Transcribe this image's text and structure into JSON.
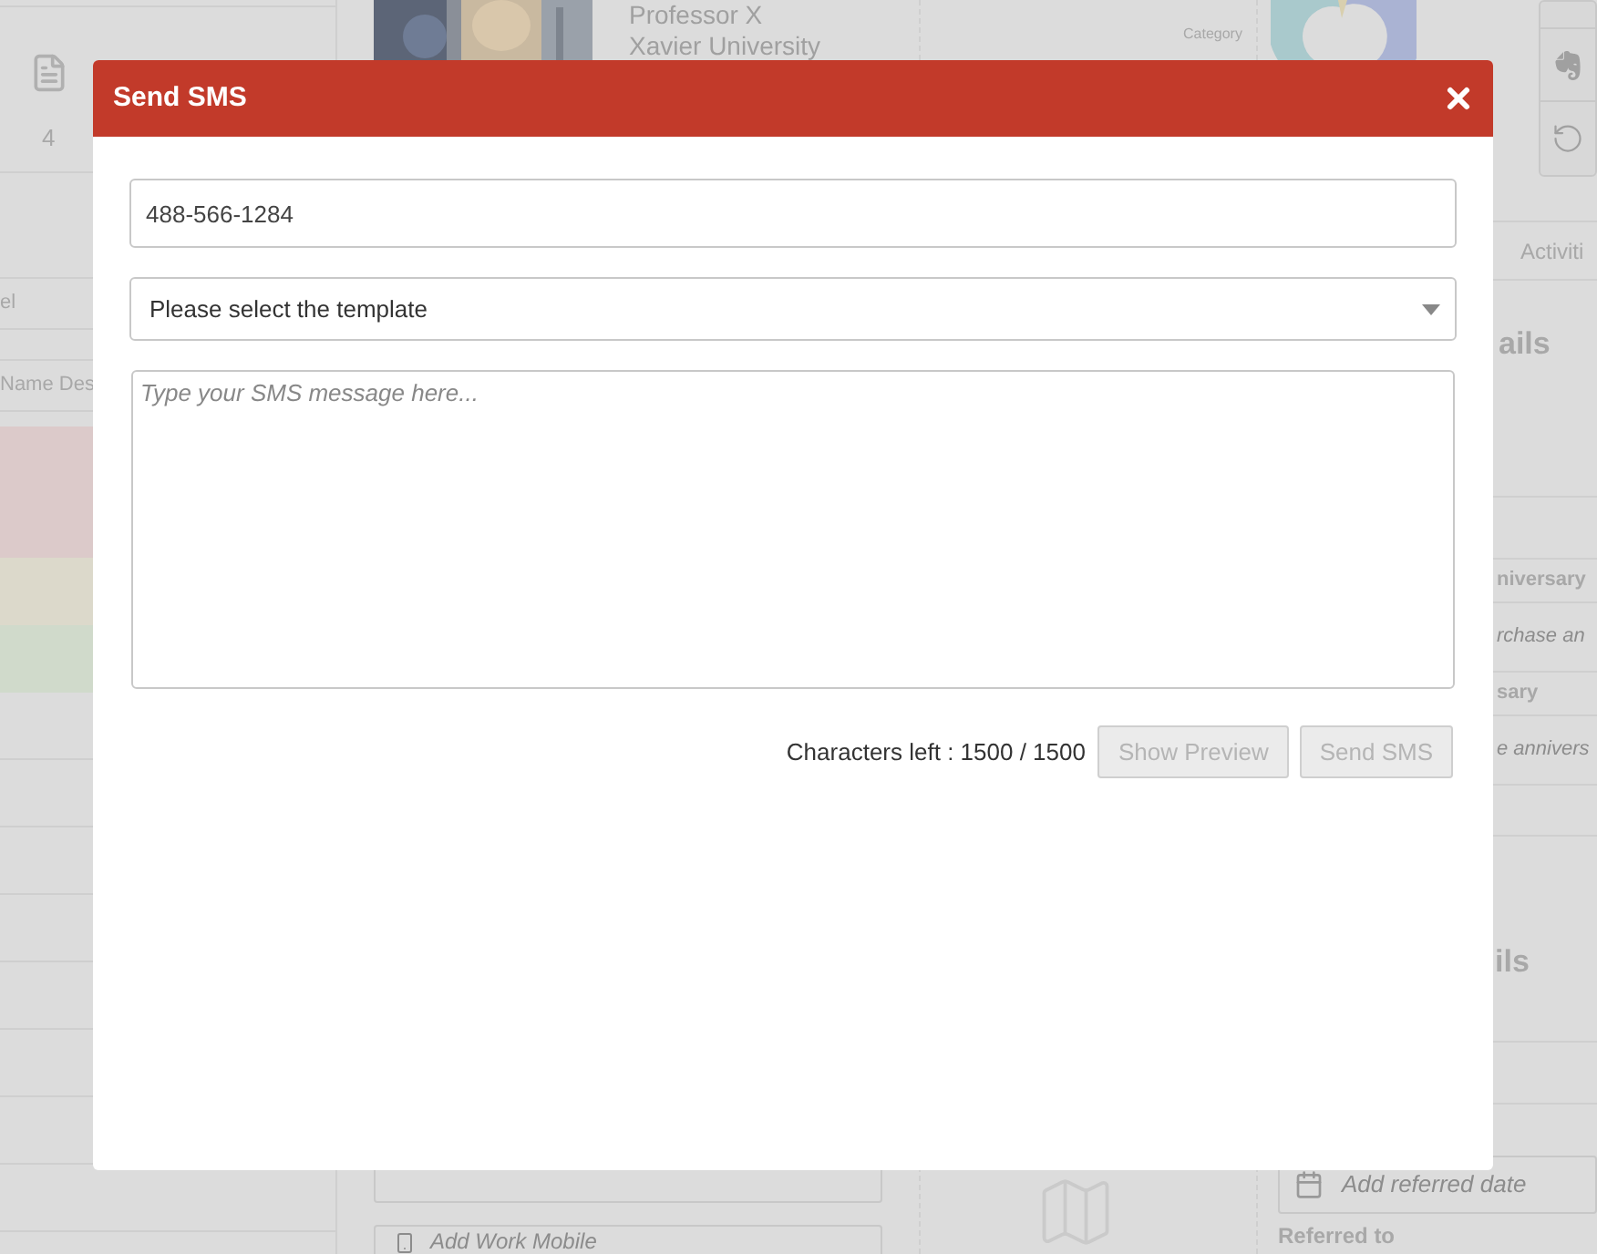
{
  "background": {
    "sidebar": {
      "count": "4",
      "fields": [
        "el",
        "Name Des"
      ],
      "rows": [
        {
          "color": "#dccaca"
        },
        {
          "color": "#dcd9cb"
        },
        {
          "color": "#d0dacb"
        }
      ]
    },
    "profile": {
      "name": "Professor X",
      "company": "Xavier University",
      "work_mobile_placeholder": "Add Work Mobile"
    },
    "chart": {
      "label": "Category"
    },
    "details": {
      "tab": "Activiti",
      "heading": "ails",
      "fields": [
        {
          "kind": "label",
          "text": "niversary"
        },
        {
          "kind": "placeholder",
          "text": "rchase an"
        },
        {
          "kind": "label",
          "text": "sary"
        },
        {
          "kind": "placeholder",
          "text": "e annivers"
        }
      ],
      "heading_2": "ils",
      "referred_date_placeholder": "Add referred date",
      "referred_to": "Referred to"
    }
  },
  "modal": {
    "title": "Send SMS",
    "phone": "488-566-1284",
    "template_placeholder": "Please select the template",
    "message_placeholder": "Type your SMS message here...",
    "counter": "Characters left : 1500 / 1500",
    "buttons": [
      {
        "label": "Show Preview",
        "disabled": true
      },
      {
        "label": "Send SMS",
        "disabled": true
      }
    ]
  }
}
